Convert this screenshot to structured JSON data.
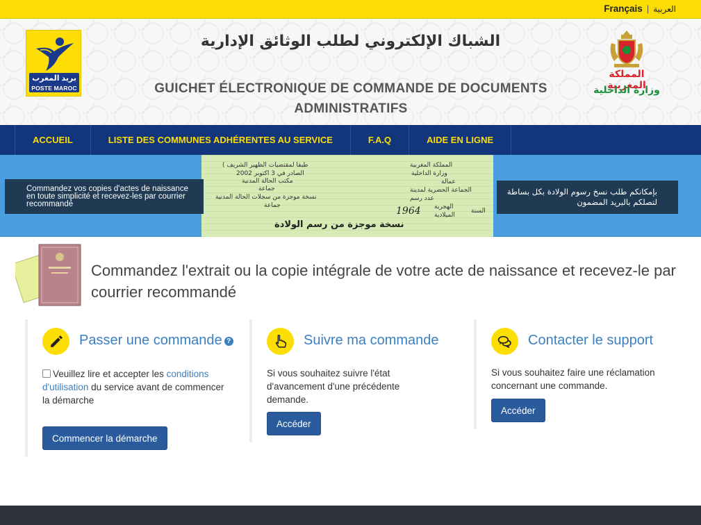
{
  "lang": {
    "current": "Français",
    "separator": "|",
    "other": "العربية"
  },
  "header": {
    "logo_left": {
      "arabic": "بريد المغرب",
      "latin": "POSTE MAROC"
    },
    "title_ar": "الشباك الإلكتروني لطلب الوثائق الإدارية",
    "title_fr": "GUICHET ÉLECTRONIQUE DE COMMANDE DE DOCUMENTS ADMINISTRATIFS",
    "logo_right": {
      "line1": "المملكة المغربية",
      "line2": "وزارة الداخلية"
    }
  },
  "nav": {
    "items": [
      {
        "label": "ACCUEIL"
      },
      {
        "label": "LISTE DES COMMUNES ADHÉRENTES AU SERVICE"
      },
      {
        "label": "F.A.Q"
      },
      {
        "label": "AIDE EN LIGNE"
      }
    ]
  },
  "banner": {
    "left_text": "Commandez vos copies d'actes de naissance en toute simplicité et recevez-les par courrier recommandé",
    "right_text": "بإمكانكم طلب نسخ رسوم الولادة بكل بساطة لتصلكم بالبريد المضمون",
    "document": {
      "lines": [
        "( طبقا لمقتضيات الظهير الشريف",
        "الصادر في 3 اكتوبر 2002",
        "مكتب الحالة المدنية",
        "جماعة",
        "نسخة موجزة من سجلات الحالة المدنية",
        "جماعة",
        "المملكة المغربية",
        "وزارة الداخلية",
        "عمالة",
        "الجماعة الحضرية لمدينة",
        "عدد رسم",
        "الهجرية",
        "السنة",
        "الميلادية"
      ],
      "year": "1964",
      "heading": "نسخة موجزة من رسم الولادة"
    }
  },
  "intro": {
    "text": "Commandez l'extrait ou la copie intégrale de votre acte de naissance et recevez-le par courrier recommandé"
  },
  "cards": [
    {
      "icon": "pencil-icon",
      "title": "Passer une commande",
      "help_icon": "?",
      "text_before": "Veuillez lire et accepter les ",
      "link_text": "conditions d'utilisation",
      "text_after": " du service avant de commencer la démarche",
      "button": "Commencer la démarche"
    },
    {
      "icon": "hand-pointer-icon",
      "title": "Suivre ma commande",
      "text": "Si vous souhaitez suivre l'état d'avancement d'une précédente demande.",
      "button": "Accéder"
    },
    {
      "icon": "chat-bubbles-icon",
      "title": "Contacter le support",
      "text": "Si vous souhaitez faire une réclamation concernant une commande.",
      "button": "Accéder"
    }
  ],
  "colors": {
    "yellow": "#fcde05",
    "navy": "#12357b",
    "banner_blue": "#4a9ddf",
    "link_blue": "#3c7fbf",
    "button_blue": "#2a5b9c"
  }
}
